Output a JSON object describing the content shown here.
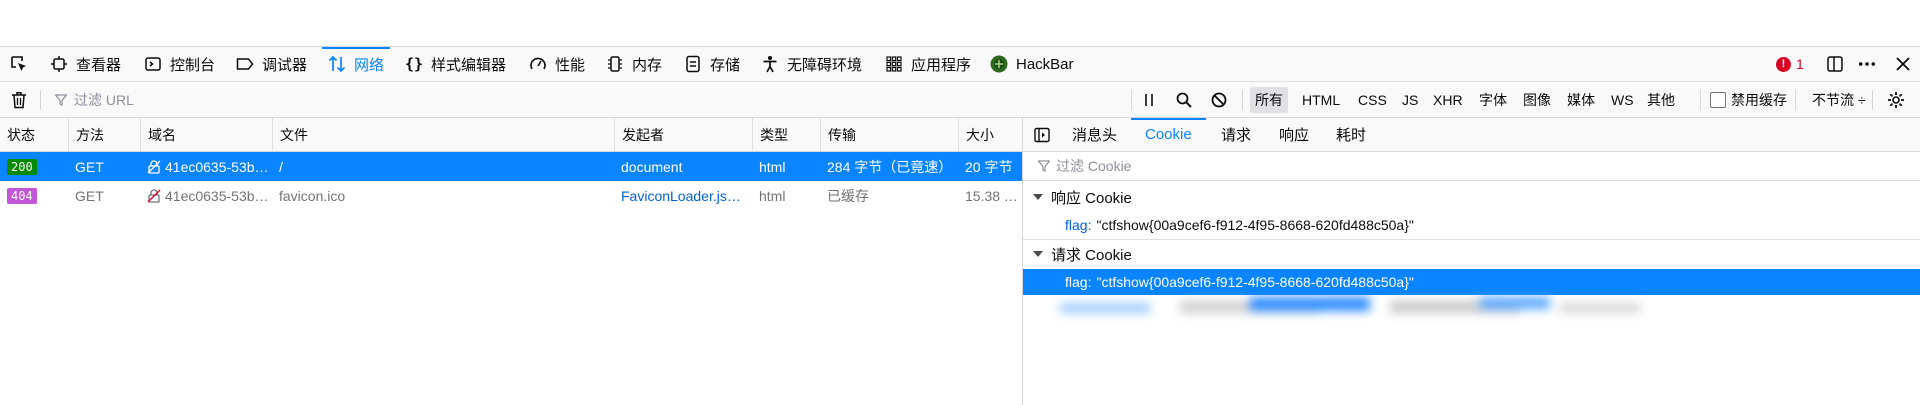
{
  "toolbar": {
    "tabs": [
      {
        "label": "查看器"
      },
      {
        "label": "控制台"
      },
      {
        "label": "调试器"
      },
      {
        "label": "网络"
      },
      {
        "label": "样式编辑器"
      },
      {
        "label": "性能"
      },
      {
        "label": "内存"
      },
      {
        "label": "存储"
      },
      {
        "label": "无障碍环境"
      },
      {
        "label": "应用程序"
      },
      {
        "label": "HackBar"
      }
    ],
    "active_tab": "网络",
    "error_count": "1"
  },
  "filter": {
    "placeholder": "过滤 URL",
    "type_buttons": [
      "所有",
      "HTML",
      "CSS",
      "JS",
      "XHR",
      "字体",
      "图像",
      "媒体",
      "WS",
      "其他"
    ],
    "disable_cache_label": "禁用缓存",
    "throttle_label": "不节流 ÷"
  },
  "table": {
    "headers": [
      "状态",
      "方法",
      "域名",
      "文件",
      "发起者",
      "类型",
      "传输",
      "大小"
    ],
    "rows": [
      {
        "status": "200",
        "method": "GET",
        "domain": "41ec0635-53b…",
        "file": "/",
        "initiator": "document",
        "type": "html",
        "transferred": "284 字节（已竟速）",
        "size": "20 字节"
      },
      {
        "status": "404",
        "method": "GET",
        "domain": "41ec0635-53b…",
        "file": "favicon.ico",
        "initiator": "FaviconLoader.js…",
        "type": "html",
        "transferred": "已缓存",
        "size": "15.38 …"
      }
    ]
  },
  "side_panel": {
    "tabs": [
      "消息头",
      "Cookie",
      "请求",
      "响应",
      "耗时"
    ],
    "active_tab": "Cookie",
    "filter_placeholder": "过滤 Cookie",
    "response_section": "响应 Cookie",
    "request_section": "请求 Cookie",
    "response_cookie": {
      "key": "flag:",
      "value": "\"ctfshow{00a9cef6-f912-4f95-8668-620fd488c50a}\""
    },
    "request_cookie": {
      "key": "flag:",
      "value": "\"ctfshow{00a9cef6-f912-4f95-8668-620fd488c50a}\""
    }
  },
  "colors": {
    "accent": "#0a84ff",
    "status_ok": "#058b00",
    "status_404": "#c355d8",
    "error": "#d70022"
  }
}
